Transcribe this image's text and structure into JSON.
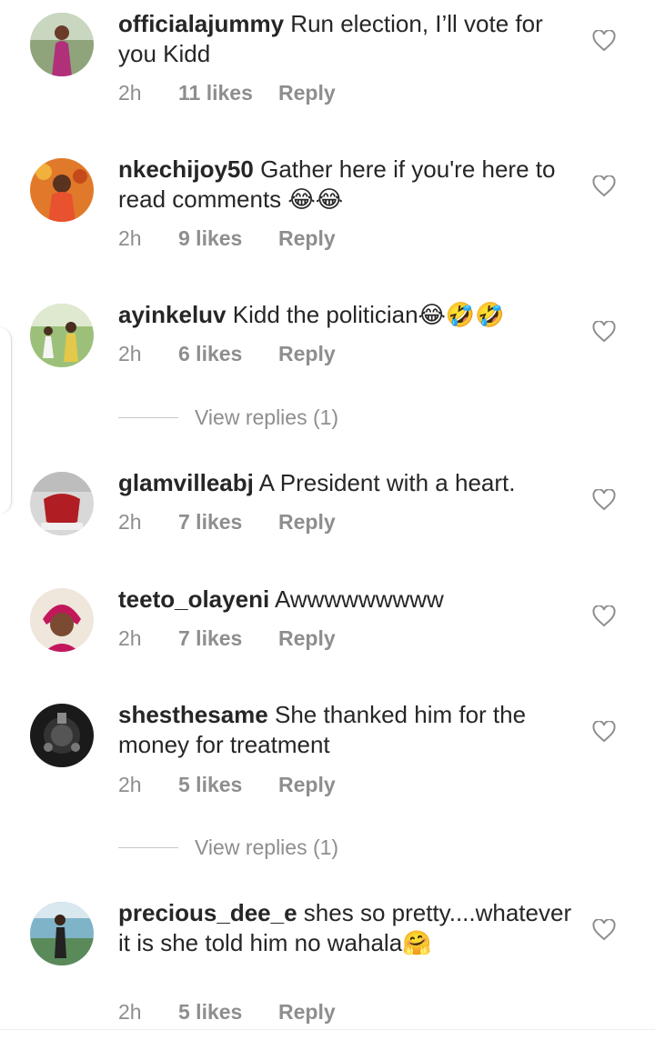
{
  "comments": [
    {
      "username": "officialajummy",
      "text": "Run election, I’ll vote for you Kidd",
      "time": "2h",
      "likes": "11 likes",
      "reply": "Reply",
      "avatar_color": "#6b7f5a"
    },
    {
      "username": "nkechijoy50",
      "text": "Gather here if you're here to read comments 😂😂",
      "time": "2h",
      "likes": "9 likes",
      "reply": "Reply",
      "avatar_color": "#d9632b"
    },
    {
      "username": "ayinkeluv",
      "text": "Kidd the politician😂🤣🤣",
      "time": "2h",
      "likes": "6 likes",
      "reply": "Reply",
      "avatar_color": "#7ea55a"
    },
    {
      "username": "glamvilleabj",
      "text": "A President with a heart.",
      "time": "2h",
      "likes": "7 likes",
      "reply": "Reply",
      "avatar_color": "#b52a2a"
    },
    {
      "username": "teeto_olayeni",
      "text": "Awwwwwwwww",
      "time": "2h",
      "likes": "7 likes",
      "reply": "Reply",
      "avatar_color": "#c2185b"
    },
    {
      "username": "shesthesame",
      "text": "She thanked him for the money for treatment",
      "time": "2h",
      "likes": "5 likes",
      "reply": "Reply",
      "avatar_color": "#222222"
    },
    {
      "username": "precious_dee_e",
      "text": "shes so pretty....whatever it is she told him no wahala🤗",
      "time": "2h",
      "likes": "5 likes",
      "reply": "Reply",
      "avatar_color": "#5a8fa8"
    }
  ],
  "view_replies": [
    {
      "label": "View replies (1)"
    },
    {
      "label": "View replies (1)"
    }
  ],
  "icons": {
    "like": "heart-outline-icon"
  },
  "colors": {
    "text": "#262626",
    "secondary": "#8e8e8e"
  }
}
